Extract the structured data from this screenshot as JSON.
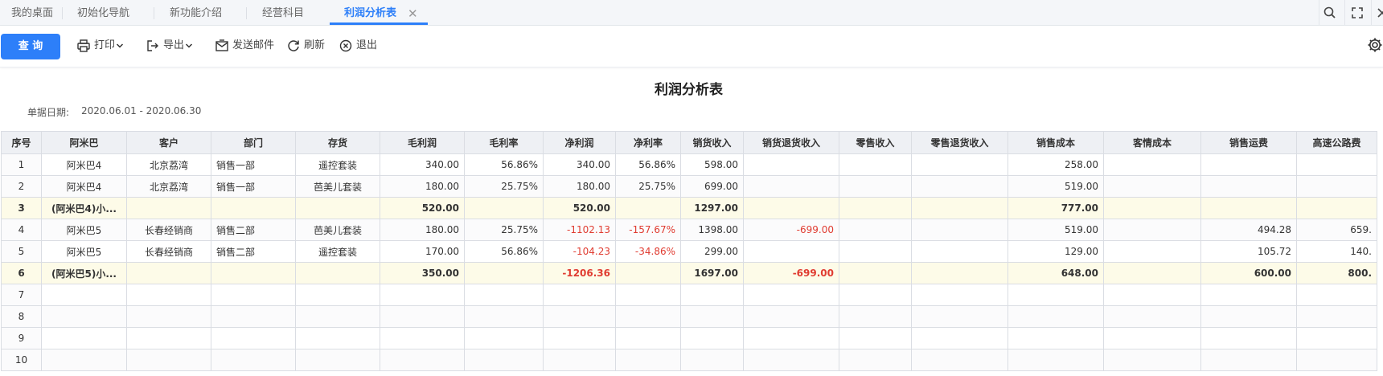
{
  "tabs": [
    {
      "label": "我的桌面"
    },
    {
      "label": "初始化导航"
    },
    {
      "label": "新功能介绍"
    },
    {
      "label": "经营科目"
    },
    {
      "label": "利润分析表"
    }
  ],
  "toolbar": {
    "query": "查 询",
    "print": "打印",
    "export": "导出",
    "email": "发送邮件",
    "refresh": "刷新",
    "exit": "退出"
  },
  "report": {
    "title": "利润分析表",
    "date_label": "单据日期:",
    "date_value": "2020.06.01 - 2020.06.30"
  },
  "table": {
    "columns": [
      "序号",
      "阿米巴",
      "客户",
      "部门",
      "存货",
      "毛利润",
      "毛利率",
      "净利润",
      "净利率",
      "销货收入",
      "销货退货收入",
      "零售收入",
      "零售退货收入",
      "销售成本",
      "客情成本",
      "销售运费",
      "高速公路费"
    ],
    "rows": [
      {
        "type": "normal",
        "cells": [
          "1",
          "阿米巴4",
          "北京荔湾",
          "销售一部",
          "遥控套装",
          "340.00",
          "56.86%",
          "340.00",
          "56.86%",
          "598.00",
          "",
          "",
          "",
          "258.00",
          "",
          "",
          ""
        ]
      },
      {
        "type": "normal",
        "cells": [
          "2",
          "阿米巴4",
          "北京荔湾",
          "销售一部",
          "芭美儿套装",
          "180.00",
          "25.75%",
          "180.00",
          "25.75%",
          "699.00",
          "",
          "",
          "",
          "519.00",
          "",
          "",
          ""
        ]
      },
      {
        "type": "sub",
        "cells": [
          "3",
          "(阿米巴4)小...",
          "",
          "",
          "",
          "520.00",
          "",
          "520.00",
          "",
          "1297.00",
          "",
          "",
          "",
          "777.00",
          "",
          "",
          ""
        ]
      },
      {
        "type": "normal",
        "cells": [
          "4",
          "阿米巴5",
          "长春经销商",
          "销售二部",
          "芭美儿套装",
          "180.00",
          "25.75%",
          "-1102.13",
          "-157.67%",
          "1398.00",
          "-699.00",
          "",
          "",
          "519.00",
          "",
          "494.28",
          "659."
        ]
      },
      {
        "type": "normal",
        "cells": [
          "5",
          "阿米巴5",
          "长春经销商",
          "销售二部",
          "遥控套装",
          "170.00",
          "56.86%",
          "-104.23",
          "-34.86%",
          "299.00",
          "",
          "",
          "",
          "129.00",
          "",
          "105.72",
          "140."
        ]
      },
      {
        "type": "sub",
        "cells": [
          "6",
          "(阿米巴5)小...",
          "",
          "",
          "",
          "350.00",
          "",
          "-1206.36",
          "",
          "1697.00",
          "-699.00",
          "",
          "",
          "648.00",
          "",
          "600.00",
          "800."
        ]
      },
      {
        "type": "empty",
        "cells": [
          "7",
          "",
          "",
          "",
          "",
          "",
          "",
          "",
          "",
          "",
          "",
          "",
          "",
          "",
          "",
          "",
          ""
        ]
      },
      {
        "type": "empty",
        "cells": [
          "8",
          "",
          "",
          "",
          "",
          "",
          "",
          "",
          "",
          "",
          "",
          "",
          "",
          "",
          "",
          "",
          ""
        ]
      },
      {
        "type": "empty",
        "cells": [
          "9",
          "",
          "",
          "",
          "",
          "",
          "",
          "",
          "",
          "",
          "",
          "",
          "",
          "",
          "",
          "",
          ""
        ]
      },
      {
        "type": "empty",
        "cells": [
          "10",
          "",
          "",
          "",
          "",
          "",
          "",
          "",
          "",
          "",
          "",
          "",
          "",
          "",
          "",
          "",
          ""
        ]
      }
    ]
  },
  "colors": {
    "accent": "#2d7ff9",
    "negative": "#e03c31",
    "subtotal_bg": "#fdfbe8",
    "header_bg": "#eef0f4"
  },
  "icons": [
    "search-icon",
    "fullscreen-icon",
    "close-icon",
    "printer-icon",
    "export-icon",
    "mail-icon",
    "refresh-icon",
    "exit-icon",
    "gear-icon",
    "chevron-down-icon"
  ]
}
